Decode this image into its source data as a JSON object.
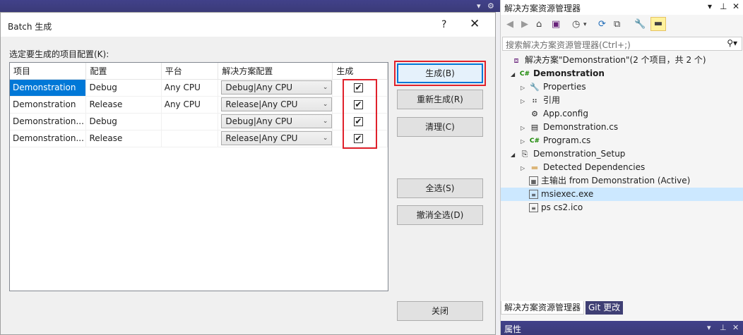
{
  "editor_bar": {
    "dropdown_glyph": "▾",
    "gear_glyph": "⚙"
  },
  "dialog": {
    "title": "Batch 生成",
    "help": "?",
    "close": "✕",
    "instruction": "选定要生成的项目配置(K):",
    "columns": [
      "项目",
      "配置",
      "平台",
      "解决方案配置",
      "生成"
    ],
    "rows": [
      {
        "project": "Demonstration",
        "config": "Debug",
        "platform": "Any CPU",
        "solution_config": "Debug|Any CPU",
        "build": true
      },
      {
        "project": "Demonstration",
        "config": "Release",
        "platform": "Any CPU",
        "solution_config": "Release|Any CPU",
        "build": true
      },
      {
        "project": "Demonstration...",
        "config": "Debug",
        "platform": "",
        "solution_config": "Debug|Any CPU",
        "build": true
      },
      {
        "project": "Demonstration...",
        "config": "Release",
        "platform": "",
        "solution_config": "Release|Any CPU",
        "build": true
      }
    ],
    "buttons": {
      "build": "生成(B)",
      "rebuild": "重新生成(R)",
      "clean": "清理(C)",
      "select_all": "全选(S)",
      "deselect_all": "撤消全选(D)",
      "close": "关闭"
    },
    "colors": {
      "highlight": "#e0212b",
      "selection": "#0078d7"
    }
  },
  "solution_explorer": {
    "title": "解决方案资源管理器",
    "search_placeholder": "搜索解决方案资源管理器(Ctrl+;)",
    "tree": {
      "solution": "解决方案\"Demonstration\"(2 个项目，共 2 个)",
      "project1": "Demonstration",
      "properties": "Properties",
      "references": "引用",
      "app_config": "App.config",
      "demonstration_cs": "Demonstration.cs",
      "program_cs": "Program.cs",
      "project2": "Demonstration_Setup",
      "detected_deps": "Detected Dependencies",
      "primary_output": "主输出 from Demonstration (Active)",
      "msiexec": "msiexec.exe",
      "ps_icon": "ps cs2.ico"
    },
    "tabs": [
      "解决方案资源管理器",
      "Git 更改"
    ],
    "properties_panel_title": "属性"
  }
}
